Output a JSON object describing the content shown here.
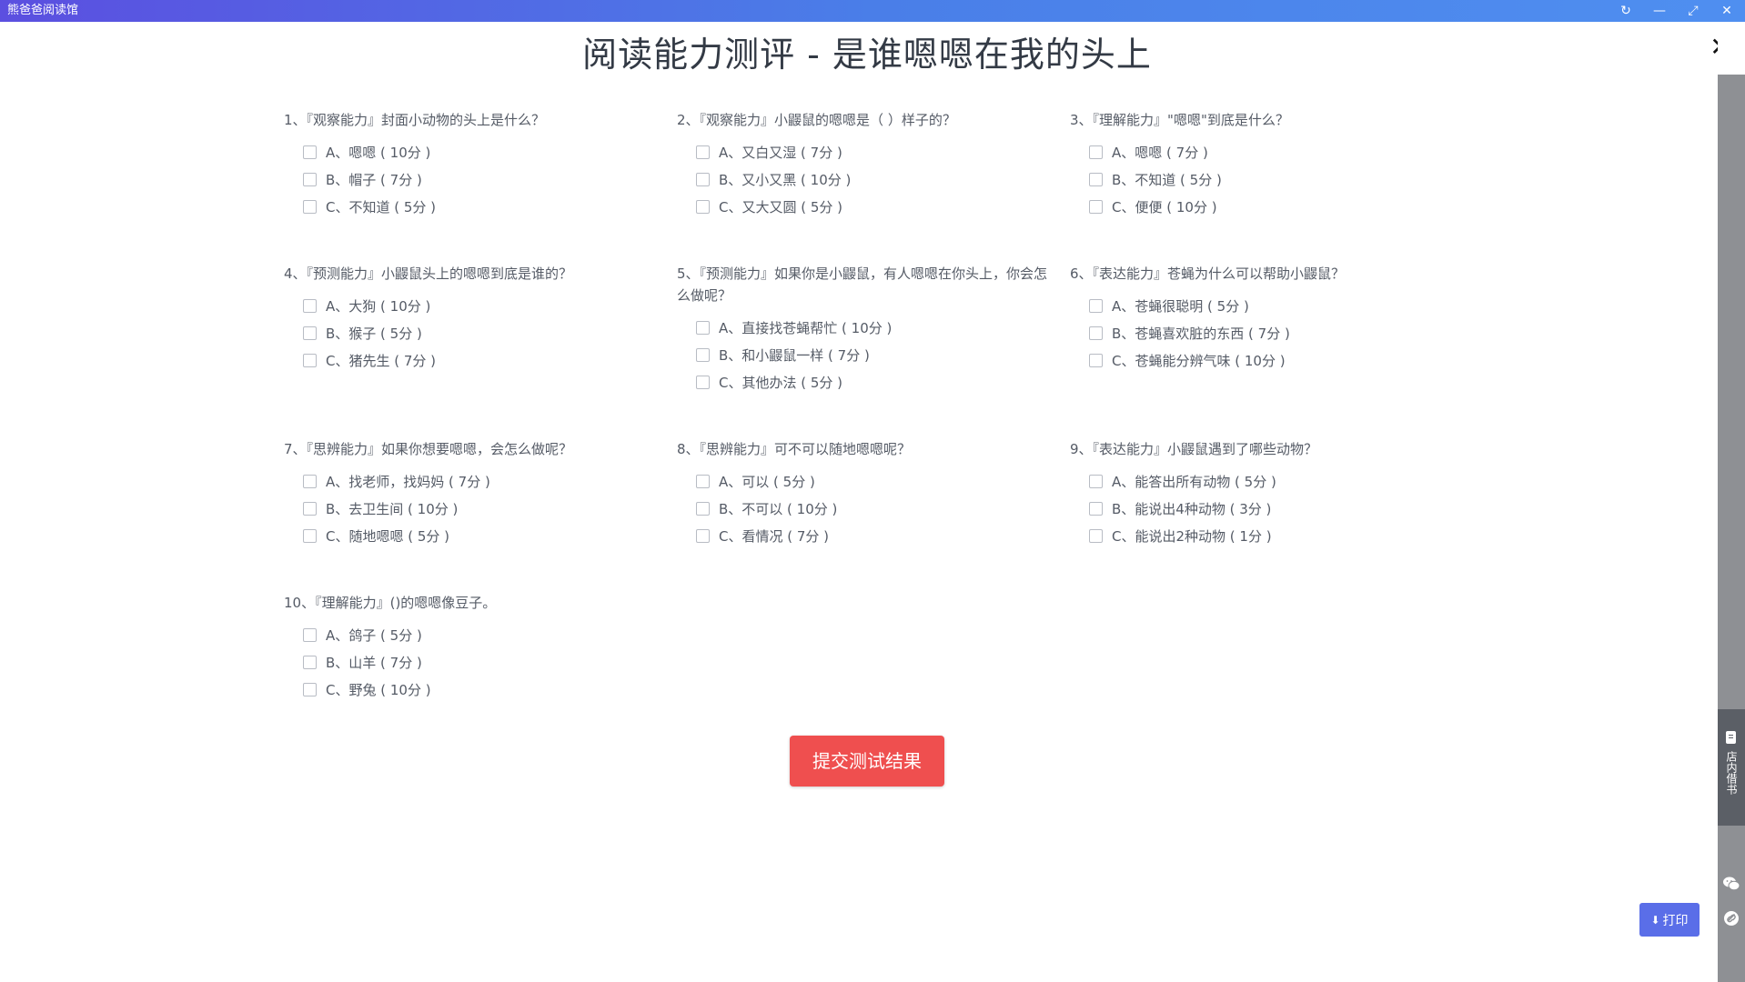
{
  "window": {
    "title": "熊爸爸阅读馆",
    "buttons": {
      "refresh": "↻",
      "minimize": "—",
      "maximize": "⤢",
      "close": "✕"
    }
  },
  "page": {
    "title": "阅读能力测评 - 是谁嗯嗯在我的头上",
    "close_label": "✕"
  },
  "questions": [
    {
      "text": "1、『观察能力』封面小动物的头上是什么？",
      "options": [
        "A、嗯嗯 ( 10分 )",
        "B、帽子 ( 7分 )",
        "C、不知道 ( 5分 )"
      ]
    },
    {
      "text": "2、『观察能力』小鼹鼠的嗯嗯是（ ）样子的？",
      "options": [
        "A、又白又湿 ( 7分 )",
        "B、又小又黑 ( 10分 )",
        "C、又大又圆 ( 5分 )"
      ]
    },
    {
      "text": "3、『理解能力』\"嗯嗯\"到底是什么？",
      "options": [
        "A、嗯嗯 ( 7分 )",
        "B、不知道 ( 5分 )",
        "C、便便 ( 10分 )"
      ]
    },
    {
      "text": "4、『预测能力』小鼹鼠头上的嗯嗯到底是谁的？",
      "options": [
        "A、大狗 ( 10分 )",
        "B、猴子 ( 5分 )",
        "C、猪先生 ( 7分 )"
      ]
    },
    {
      "text": "5、『预测能力』如果你是小鼹鼠，有人嗯嗯在你头上，你会怎么做呢？",
      "options": [
        "A、直接找苍蝇帮忙 ( 10分 )",
        "B、和小鼹鼠一样 ( 7分 )",
        "C、其他办法 ( 5分 )"
      ]
    },
    {
      "text": "6、『表达能力』苍蝇为什么可以帮助小鼹鼠？",
      "options": [
        "A、苍蝇很聪明 ( 5分 )",
        "B、苍蝇喜欢脏的东西 ( 7分 )",
        "C、苍蝇能分辨气味 ( 10分 )"
      ]
    },
    {
      "text": "7、『思辨能力』如果你想要嗯嗯，会怎么做呢？",
      "options": [
        "A、找老师，找妈妈 ( 7分 )",
        "B、去卫生间 ( 10分 )",
        "C、随地嗯嗯 ( 5分 )"
      ]
    },
    {
      "text": "8、『思辨能力』可不可以随地嗯嗯呢？",
      "options": [
        "A、可以 ( 5分 )",
        "B、不可以 ( 10分 )",
        "C、看情况 ( 7分 )"
      ]
    },
    {
      "text": "9、『表达能力』小鼹鼠遇到了哪些动物？",
      "options": [
        "A、能答出所有动物 ( 5分 )",
        "B、能说出4种动物 ( 3分 )",
        "C、能说出2种动物 ( 1分 )"
      ]
    },
    {
      "text": "10、『理解能力』()的嗯嗯像豆子。",
      "options": [
        "A、鸽子 ( 5分 )",
        "B、山羊 ( 7分 )",
        "C、野兔 ( 10分 )"
      ]
    }
  ],
  "submit_label": "提交测试结果",
  "sidebar": {
    "borrow_label": "店内借书",
    "wechat_icon": "wechat-icon",
    "link_icon": "link-icon"
  },
  "print_label": "打印",
  "colors": {
    "accent": "#5a6ee8",
    "submit": "#ef4f4f",
    "titlebar": "#4f7ee8"
  }
}
